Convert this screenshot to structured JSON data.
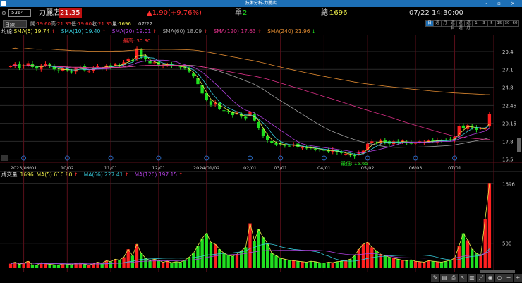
{
  "window": {
    "title": "技術分析-力麗店",
    "controls": "- ▫ ×"
  },
  "header": {
    "code": "5364",
    "name": "力麗店",
    "price": "21.35",
    "change": "▲1.90(+9.76%)",
    "single_label": "單:",
    "single": "2",
    "total_label": "總:",
    "total": "1696",
    "time": "07/22 14:30:00"
  },
  "quote_row": {
    "period_select": "日線",
    "open_label": "開:",
    "open": "19.60",
    "high_label": "高:",
    "high": "21.35",
    "low_label": "低:",
    "low": "19.60",
    "close_label": "收:",
    "close": "21.35",
    "vol_label": "量:",
    "vol": "1696",
    "date": "07/22"
  },
  "periods": [
    "日",
    "週",
    "月",
    "還日",
    "還週",
    "還月",
    "1",
    "3",
    "5",
    "15",
    "30",
    "60"
  ],
  "active_period": "日",
  "ma_legend": {
    "label": "均線:",
    "items": [
      {
        "text": "SMA(5) 19.74",
        "arrow": "↑",
        "color": "#e8e84a"
      },
      {
        "text": "SMA(10) 19.40",
        "arrow": "↑",
        "color": "#36c8d8"
      },
      {
        "text": "SMA(20) 19.01",
        "arrow": "↑",
        "color": "#b040e0"
      },
      {
        "text": "SMA(60) 18.09",
        "arrow": "↑",
        "color": "#a0a0a0"
      },
      {
        "text": "SMA(120) 17.63",
        "arrow": "↑",
        "color": "#e0308a"
      },
      {
        "text": "SMA(240) 21.96",
        "arrow": "↓",
        "color": "#e08a30"
      }
    ]
  },
  "vol_legend": {
    "label": "成交量",
    "value": "1696",
    "items": [
      {
        "text": "MA(5) 610.80",
        "arrow": "↑",
        "color": "#e8e84a"
      },
      {
        "text": "MA(66) 227.41",
        "arrow": "↑",
        "color": "#36c8d8"
      },
      {
        "text": "MA(120) 197.15",
        "arrow": "↑",
        "color": "#b040e0"
      }
    ]
  },
  "colors": {
    "up": "#ff2020",
    "down": "#20e020",
    "grid": "#5a0f1a",
    "axis_text": "#cccccc"
  },
  "chart_data": {
    "type": "candlestick",
    "max_label": "最高: 30.30",
    "min_label": "最低: 15.65",
    "yticks": [
      29.4,
      27.1,
      24.8,
      22.45,
      20.15,
      17.8,
      15.5
    ],
    "ylim": [
      15.1,
      31.5
    ],
    "vol_ticks": [
      1696,
      500
    ],
    "vol_lim": [
      0,
      1800
    ],
    "xticks": [
      {
        "label": "2023/09/01",
        "at": 3
      },
      {
        "label": "10/02",
        "at": 13
      },
      {
        "label": "11/01",
        "at": 23
      },
      {
        "label": "12/01",
        "at": 34
      },
      {
        "label": "2024/01/02",
        "at": 45
      },
      {
        "label": "02/01",
        "at": 55
      },
      {
        "label": "03/01",
        "at": 62
      },
      {
        "label": "04/01",
        "at": 72
      },
      {
        "label": "05/02",
        "at": 82
      },
      {
        "label": "06/03",
        "at": 93
      },
      {
        "label": "07/01",
        "at": 102
      }
    ],
    "close": [
      27.5,
      27.8,
      27.3,
      27.6,
      27.9,
      27.4,
      27.2,
      27.6,
      27.8,
      27.5,
      27.1,
      26.9,
      27.3,
      27.0,
      26.8,
      27.2,
      27.4,
      27.0,
      26.9,
      27.3,
      27.5,
      27.2,
      27.6,
      27.4,
      27.8,
      27.6,
      28.0,
      28.5,
      28.2,
      29.8,
      28.7,
      28.4,
      27.9,
      28.0,
      27.7,
      27.6,
      27.8,
      27.5,
      27.6,
      27.4,
      27.2,
      26.8,
      26.2,
      25.2,
      24.0,
      23.2,
      22.5,
      22.8,
      22.0,
      21.8,
      21.6,
      21.2,
      21.5,
      21.0,
      20.8,
      21.6,
      20.5,
      19.5,
      18.5,
      18.0,
      17.6,
      17.4,
      17.5,
      17.3,
      17.2,
      17.4,
      17.1,
      17.0,
      16.9,
      17.0,
      16.8,
      16.7,
      16.6,
      16.5,
      16.7,
      16.4,
      16.3,
      16.2,
      16.0,
      15.9,
      16.3,
      16.6,
      17.5,
      17.8,
      17.6,
      17.9,
      17.7,
      17.5,
      17.8,
      17.6,
      17.9,
      17.7,
      17.5,
      17.6,
      17.8,
      17.7,
      17.9,
      17.8,
      18.0,
      17.9,
      17.9,
      18.0,
      18.4,
      19.8,
      19.5,
      19.9,
      19.6,
      19.3,
      19.5,
      19.45,
      21.35
    ],
    "volume": [
      90,
      120,
      80,
      100,
      140,
      70,
      60,
      110,
      90,
      80,
      70,
      60,
      90,
      80,
      70,
      100,
      110,
      80,
      60,
      90,
      120,
      100,
      150,
      130,
      180,
      160,
      220,
      380,
      250,
      480,
      300,
      200,
      150,
      180,
      160,
      120,
      140,
      110,
      130,
      120,
      160,
      220,
      300,
      450,
      600,
      700,
      520,
      480,
      380,
      300,
      260,
      240,
      280,
      350,
      420,
      900,
      550,
      780,
      620,
      500,
      300,
      250,
      200,
      180,
      160,
      150,
      140,
      130,
      120,
      140,
      130,
      110,
      100,
      120,
      110,
      130,
      140,
      150,
      180,
      250,
      380,
      480,
      520,
      420,
      350,
      280,
      250,
      220,
      200,
      180,
      160,
      150,
      170,
      140,
      130,
      120,
      150,
      140,
      130,
      120,
      140,
      160,
      200,
      450,
      700,
      560,
      380,
      300,
      260,
      980,
      1696
    ]
  }
}
